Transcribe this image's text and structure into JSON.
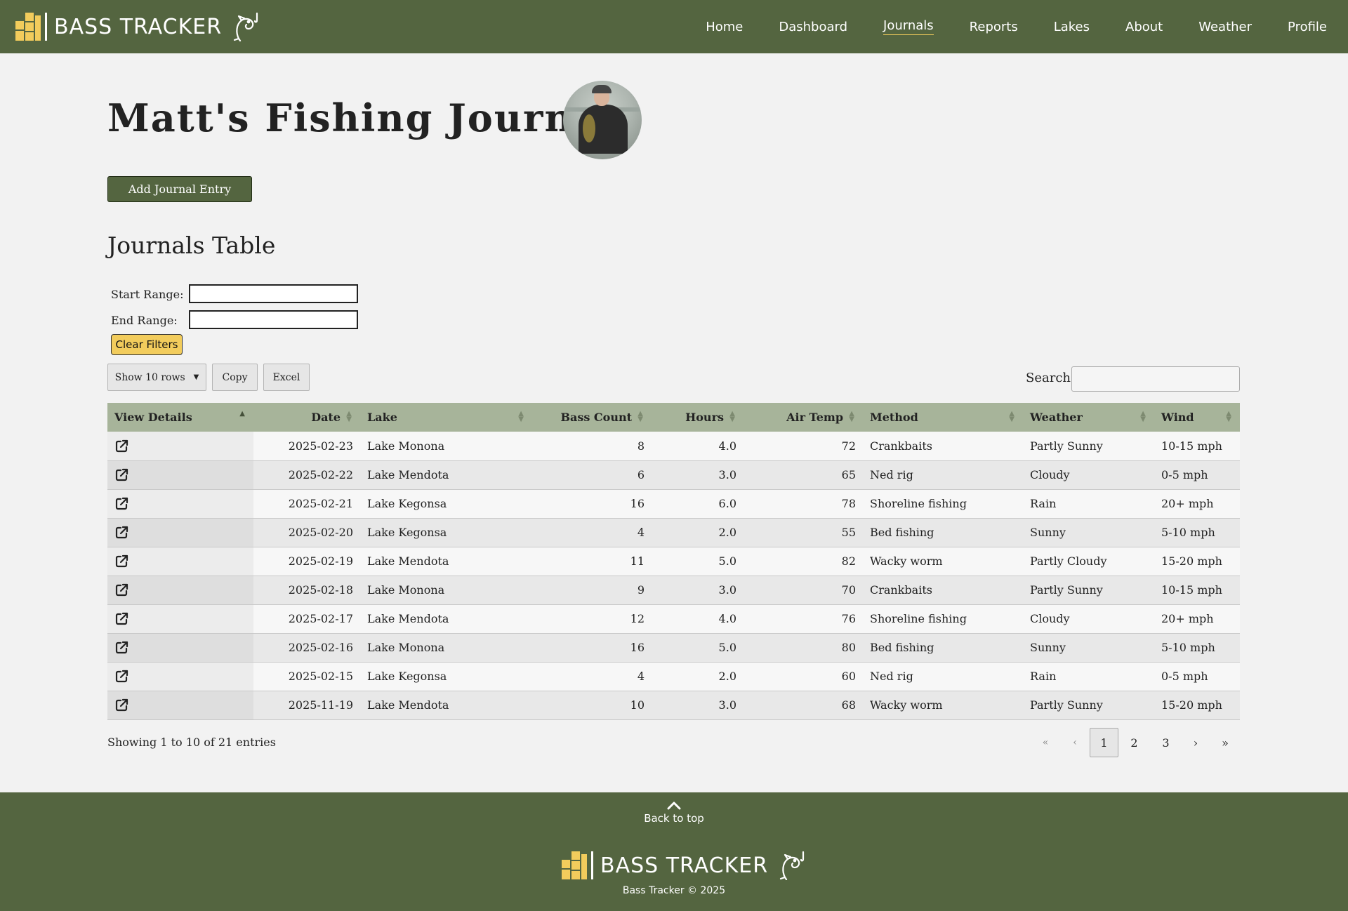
{
  "brand": {
    "name": "BASS TRACKER",
    "accent": "#f2cc5c",
    "nav_bg": "#546540"
  },
  "nav": {
    "items": [
      {
        "label": "Home"
      },
      {
        "label": "Dashboard"
      },
      {
        "label": "Journals",
        "active": true
      },
      {
        "label": "Reports"
      },
      {
        "label": "Lakes"
      },
      {
        "label": "About"
      },
      {
        "label": "Weather"
      },
      {
        "label": "Profile"
      }
    ]
  },
  "page": {
    "title": "Matt's Fishing Journals",
    "add_button": "Add Journal Entry",
    "section_title": "Journals Table"
  },
  "filters": {
    "start_label": "Start Range:",
    "start_value": "",
    "end_label": "End Range:",
    "end_value": "",
    "clear_label": "Clear Filters"
  },
  "toolbar": {
    "show_rows": "Show 10 rows",
    "copy": "Copy",
    "excel": "Excel",
    "search_label": "Search:",
    "search_value": ""
  },
  "table": {
    "columns": [
      "View Details",
      "Date",
      "Lake",
      "Bass Count",
      "Hours",
      "Air Temp",
      "Method",
      "Weather",
      "Wind"
    ],
    "rows": [
      {
        "date": "2025-02-23",
        "lake": "Lake Monona",
        "bass": "8",
        "hours": "4.0",
        "temp": "72",
        "method": "Crankbaits",
        "weather": "Partly Sunny",
        "wind": "10-15 mph"
      },
      {
        "date": "2025-02-22",
        "lake": "Lake Mendota",
        "bass": "6",
        "hours": "3.0",
        "temp": "65",
        "method": "Ned rig",
        "weather": "Cloudy",
        "wind": "0-5 mph"
      },
      {
        "date": "2025-02-21",
        "lake": "Lake Kegonsa",
        "bass": "16",
        "hours": "6.0",
        "temp": "78",
        "method": "Shoreline fishing",
        "weather": "Rain",
        "wind": "20+ mph"
      },
      {
        "date": "2025-02-20",
        "lake": "Lake Kegonsa",
        "bass": "4",
        "hours": "2.0",
        "temp": "55",
        "method": "Bed fishing",
        "weather": "Sunny",
        "wind": "5-10 mph"
      },
      {
        "date": "2025-02-19",
        "lake": "Lake Mendota",
        "bass": "11",
        "hours": "5.0",
        "temp": "82",
        "method": "Wacky worm",
        "weather": "Partly Cloudy",
        "wind": "15-20 mph"
      },
      {
        "date": "2025-02-18",
        "lake": "Lake Monona",
        "bass": "9",
        "hours": "3.0",
        "temp": "70",
        "method": "Crankbaits",
        "weather": "Partly Sunny",
        "wind": "10-15 mph"
      },
      {
        "date": "2025-02-17",
        "lake": "Lake Mendota",
        "bass": "12",
        "hours": "4.0",
        "temp": "76",
        "method": "Shoreline fishing",
        "weather": "Cloudy",
        "wind": "20+ mph"
      },
      {
        "date": "2025-02-16",
        "lake": "Lake Monona",
        "bass": "16",
        "hours": "5.0",
        "temp": "80",
        "method": "Bed fishing",
        "weather": "Sunny",
        "wind": "5-10 mph"
      },
      {
        "date": "2025-02-15",
        "lake": "Lake Kegonsa",
        "bass": "4",
        "hours": "2.0",
        "temp": "60",
        "method": "Ned rig",
        "weather": "Rain",
        "wind": "0-5 mph"
      },
      {
        "date": "2025-11-19",
        "lake": "Lake Mendota",
        "bass": "10",
        "hours": "3.0",
        "temp": "68",
        "method": "Wacky worm",
        "weather": "Partly Sunny",
        "wind": "15-20 mph"
      }
    ]
  },
  "pagination": {
    "info": "Showing 1 to 10 of 21 entries",
    "first": "«",
    "prev": "‹",
    "pages": [
      "1",
      "2",
      "3"
    ],
    "current": "1",
    "next": "›",
    "last": "»"
  },
  "footer": {
    "back_to_top": "Back to top",
    "copyright": "Bass Tracker © 2025"
  }
}
